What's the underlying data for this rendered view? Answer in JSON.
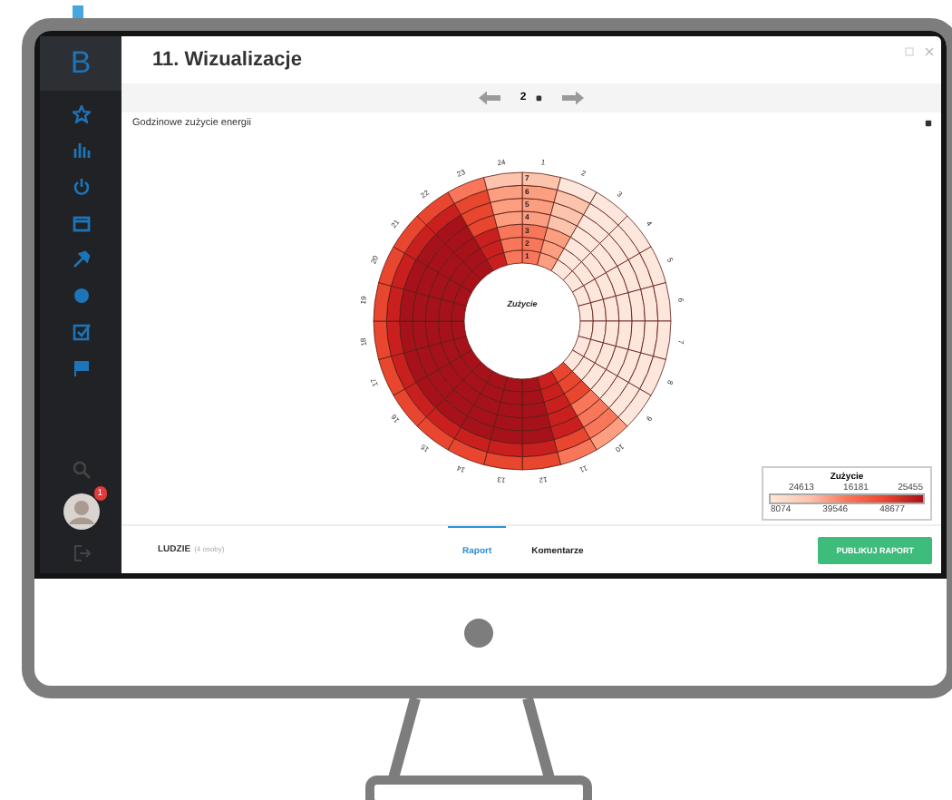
{
  "window": {
    "logo": "B",
    "title": "11. Wizualizacje"
  },
  "sidebar": {
    "badge": "1"
  },
  "pager": {
    "page": "2"
  },
  "report": {
    "title": "Godzinowe zużycie energii",
    "chart": {
      "center_label": "Zużycie",
      "hour_labels": [
        "1",
        "2",
        "3",
        "4",
        "5",
        "6",
        "7",
        "8",
        "9",
        "10",
        "11",
        "12",
        "13",
        "14",
        "15",
        "16",
        "17",
        "18",
        "19",
        "20",
        "21",
        "22",
        "23",
        "24"
      ],
      "ring_labels": [
        "7",
        "6",
        "5",
        "4",
        "3",
        "2",
        "1"
      ]
    },
    "legend": {
      "title": "Zużycie",
      "top_ticks": [
        "24613",
        "16181",
        "25455"
      ],
      "bottom_ticks": [
        "8074",
        "39546",
        "48677"
      ]
    }
  },
  "footer": {
    "people_label": "LUDZIE",
    "people_count": "(4 osoby)",
    "tabs": [
      {
        "label": "Raport",
        "selected": true
      },
      {
        "label": "Komentarze",
        "selected": false
      }
    ],
    "publish_button": "PUBLIKUJ RAPORT"
  }
}
